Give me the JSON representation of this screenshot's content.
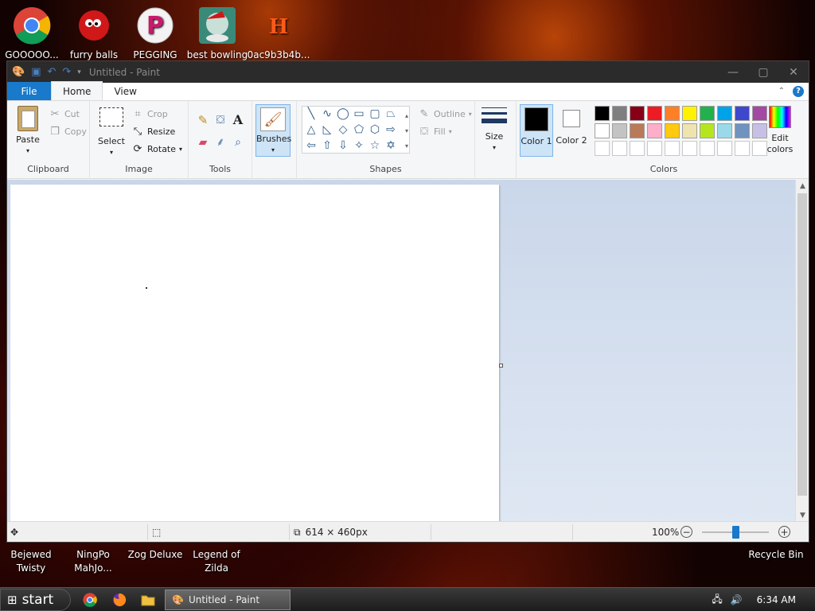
{
  "desktop": {
    "top_icons": [
      {
        "label": "GOOOOO...",
        "icon": "chrome-icon"
      },
      {
        "label": "furry balls",
        "icon": "furry-ball-icon"
      },
      {
        "label": "PEGGING",
        "icon": "pegging-icon"
      },
      {
        "label": "best bowling",
        "icon": "bowling-icon"
      },
      {
        "label": "0ac9b3b4b...",
        "icon": "h-app-icon"
      }
    ],
    "bottom_icons": [
      {
        "label": "Bejewed Twisty"
      },
      {
        "label": "NingPo MahJo..."
      },
      {
        "label": "Zog Deluxe"
      },
      {
        "label": "Legend of Zilda"
      },
      {
        "label": "Recycle Bin"
      }
    ]
  },
  "window": {
    "title": "Untitled - Paint",
    "tabs": {
      "file": "File",
      "home": "Home",
      "view": "View"
    },
    "ribbon": {
      "clipboard": {
        "label": "Clipboard",
        "paste": "Paste",
        "cut": "Cut",
        "copy": "Copy"
      },
      "image": {
        "label": "Image",
        "select": "Select",
        "crop": "Crop",
        "resize": "Resize",
        "rotate": "Rotate"
      },
      "tools": {
        "label": "Tools"
      },
      "brushes": {
        "label": "Brushes"
      },
      "shapes": {
        "label": "Shapes",
        "outline": "Outline",
        "fill": "Fill"
      },
      "size": {
        "label": "Size"
      },
      "colors": {
        "label": "Colors",
        "color1": "Color 1",
        "color2": "Color 2",
        "edit": "Edit colors",
        "color1_value": "#000000",
        "color2_value": "#ffffff",
        "palette_row1": [
          "#000000",
          "#7f7f7f",
          "#880015",
          "#ed1c24",
          "#ff7f27",
          "#fff200",
          "#22b14c",
          "#00a2e8",
          "#3f48cc",
          "#a349a4"
        ],
        "palette_row2": [
          "#ffffff",
          "#c3c3c3",
          "#b97a57",
          "#ffaec9",
          "#ffc90e",
          "#efe4b0",
          "#b5e61d",
          "#99d9ea",
          "#7092be",
          "#c8bfe7"
        ]
      }
    },
    "status": {
      "image_size": "614 × 460px",
      "zoom": "100%"
    }
  },
  "taskbar": {
    "start": "start",
    "task_label": "Untitled - Paint",
    "time": "6:34 AM"
  }
}
